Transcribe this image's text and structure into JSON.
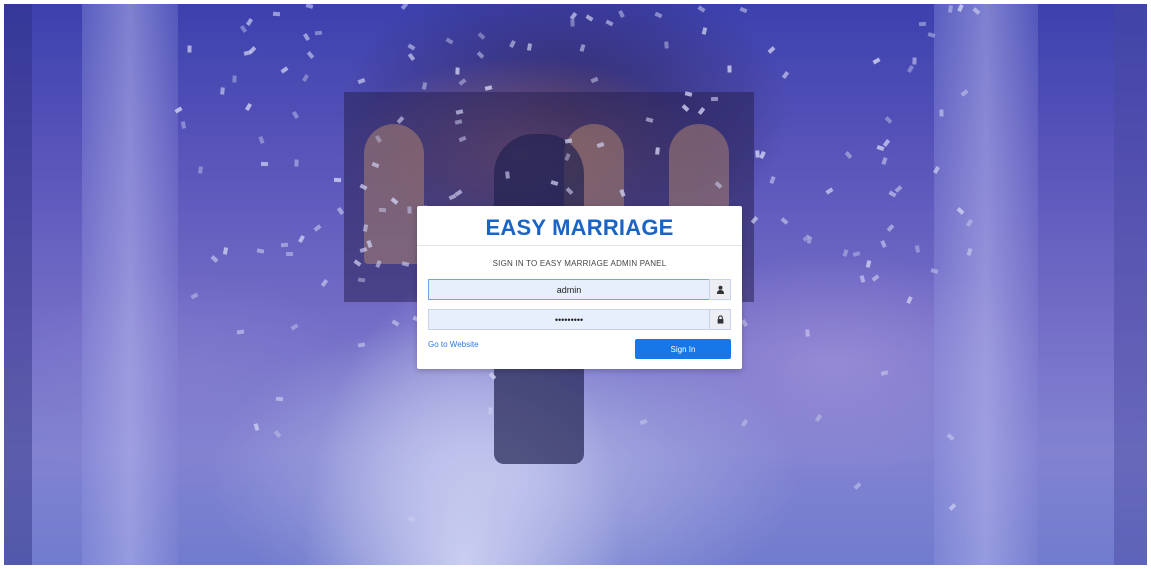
{
  "login": {
    "brand": "EASY MARRIAGE",
    "subtitle": "SIGN IN TO EASY MARRIAGE ADMIN PANEL",
    "username_value": "admin",
    "password_value": "•••••••••",
    "username_icon": "user-icon",
    "password_icon": "lock-icon",
    "website_link": "Go to Website",
    "sign_in_label": "Sign In"
  },
  "colors": {
    "brand": "#1a64c6",
    "button": "#1877e8",
    "link": "#2a7be4",
    "input_bg": "#e8effc"
  }
}
